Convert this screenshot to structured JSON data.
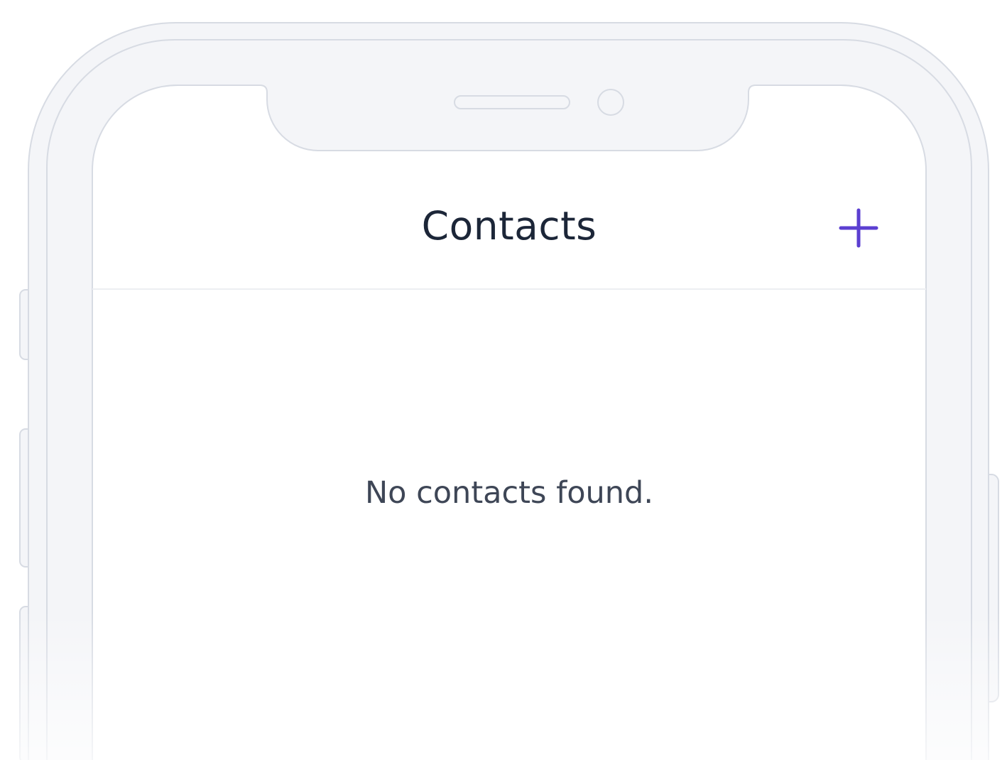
{
  "header": {
    "title": "Contacts",
    "add_icon": "plus-icon",
    "accent_color": "#5b3fd1"
  },
  "main": {
    "empty_message": "No contacts found."
  },
  "device": {
    "frame_color": "#f4f5f8",
    "frame_stroke": "#d7dbe3"
  }
}
